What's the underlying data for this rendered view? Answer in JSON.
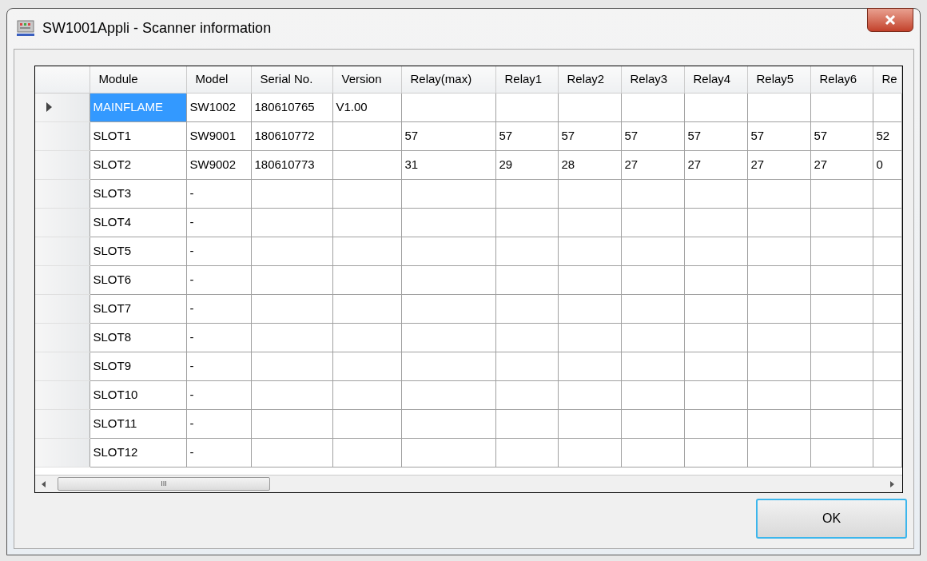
{
  "window": {
    "title": "SW1001Appli - Scanner information"
  },
  "table": {
    "columns": [
      "Module",
      "Model",
      "Serial No.",
      "Version",
      "Relay(max)",
      "Relay1",
      "Relay2",
      "Relay3",
      "Relay4",
      "Relay5",
      "Relay6",
      "Re"
    ],
    "rows": [
      {
        "selected": true,
        "cells": [
          "MAINFLAME",
          "SW1002",
          "180610765",
          "V1.00",
          null,
          null,
          null,
          null,
          null,
          null,
          null,
          null
        ]
      },
      {
        "selected": false,
        "cells": [
          "SLOT1",
          "SW9001",
          "180610772",
          null,
          "57",
          "57",
          "57",
          "57",
          "57",
          "57",
          "57",
          "52"
        ]
      },
      {
        "selected": false,
        "cells": [
          "SLOT2",
          "SW9002",
          "180610773",
          null,
          "31",
          "29",
          "28",
          "27",
          "27",
          "27",
          "27",
          "0"
        ]
      },
      {
        "selected": false,
        "cells": [
          "SLOT3",
          "-"
        ]
      },
      {
        "selected": false,
        "cells": [
          "SLOT4",
          "-"
        ]
      },
      {
        "selected": false,
        "cells": [
          "SLOT5",
          "-"
        ]
      },
      {
        "selected": false,
        "cells": [
          "SLOT6",
          "-"
        ]
      },
      {
        "selected": false,
        "cells": [
          "SLOT7",
          "-"
        ]
      },
      {
        "selected": false,
        "cells": [
          "SLOT8",
          "-"
        ]
      },
      {
        "selected": false,
        "cells": [
          "SLOT9",
          "-"
        ]
      },
      {
        "selected": false,
        "cells": [
          "SLOT10",
          "-"
        ]
      },
      {
        "selected": false,
        "cells": [
          "SLOT11",
          "-"
        ]
      },
      {
        "selected": false,
        "cells": [
          "SLOT12",
          "-"
        ]
      }
    ]
  },
  "scrollbar_thumb": "III",
  "buttons": [
    "OK"
  ]
}
